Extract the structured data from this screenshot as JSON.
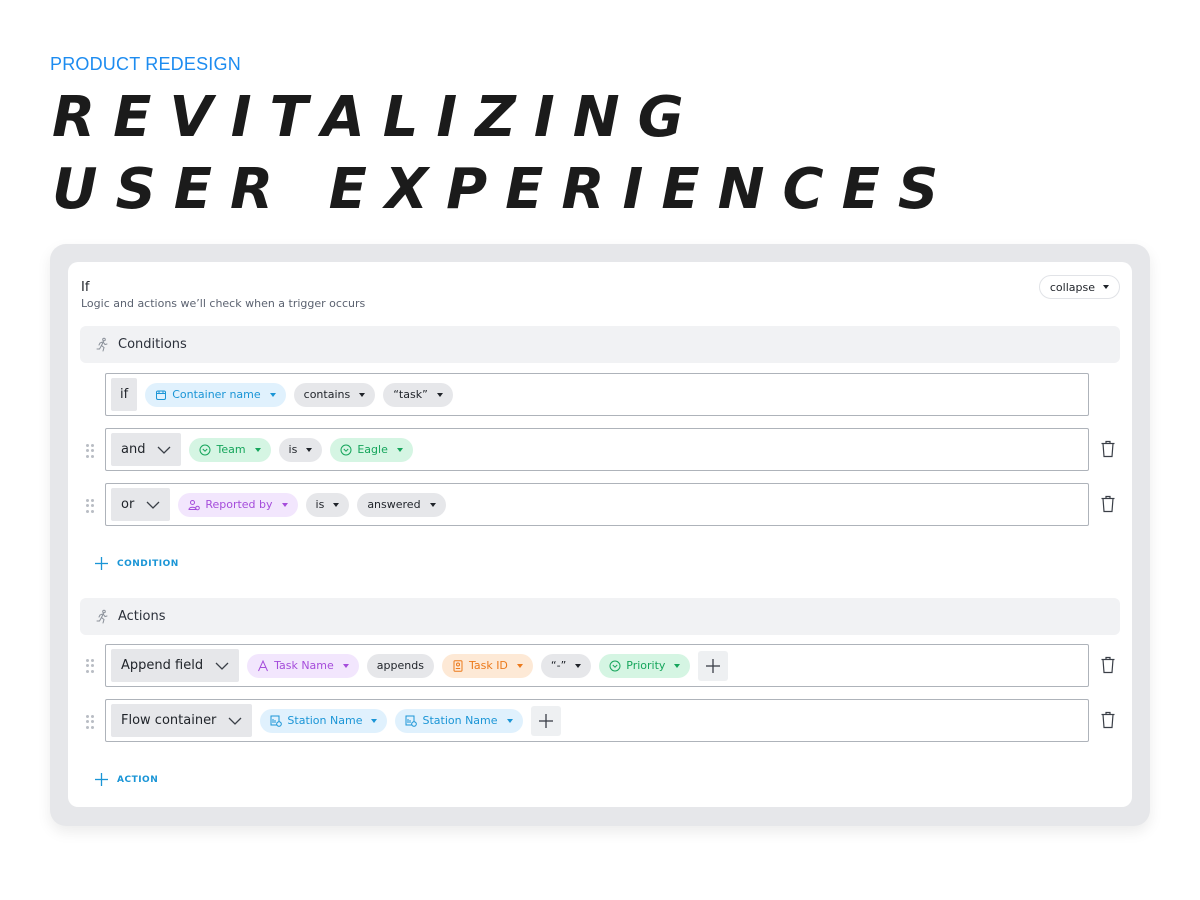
{
  "header": {
    "eyebrow": "PRODUCT REDESIGN",
    "title_line1": "REVITALIZING",
    "title_line2": "USER EXPERIENCES"
  },
  "card": {
    "title": "If",
    "subtitle": "Logic and actions we’ll check when a trigger occurs",
    "collapse_label": "collapse"
  },
  "conditions": {
    "section_label": "Conditions",
    "section_icon": "running-person-icon",
    "rows": [
      {
        "operator": "if",
        "chips": [
          {
            "label": "Container name",
            "icon": "container-icon",
            "color": "blue"
          },
          {
            "label": "contains",
            "color": "gray"
          },
          {
            "label": "“task”",
            "color": "gray"
          }
        ]
      },
      {
        "operator": "and",
        "chips": [
          {
            "label": "Team",
            "icon": "circle-chevron-icon",
            "color": "green"
          },
          {
            "label": "is",
            "color": "gray"
          },
          {
            "label": "Eagle",
            "icon": "circle-chevron-icon",
            "color": "green"
          }
        ]
      },
      {
        "operator": "or",
        "chips": [
          {
            "label": "Reported by",
            "icon": "user-icon",
            "color": "purple"
          },
          {
            "label": "is",
            "color": "gray"
          },
          {
            "label": "answered",
            "color": "gray"
          }
        ]
      }
    ],
    "add_label": "CONDITION"
  },
  "actions": {
    "section_label": "Actions",
    "section_icon": "running-person-icon",
    "rows": [
      {
        "operator": "Append field",
        "chips": [
          {
            "label": "Task Name",
            "icon": "text-icon",
            "color": "purple"
          },
          {
            "label": "appends",
            "color": "gray"
          },
          {
            "label": "Task ID",
            "icon": "id-badge-icon",
            "color": "orange"
          },
          {
            "label": "“-”",
            "color": "gray"
          },
          {
            "label": "Priority",
            "icon": "circle-chevron-icon",
            "color": "green"
          }
        ]
      },
      {
        "operator": "Flow container",
        "chips": [
          {
            "label": "Station Name",
            "icon": "station-icon",
            "color": "blue"
          },
          {
            "label": "Station Name",
            "icon": "station-icon",
            "color": "blue"
          }
        ]
      }
    ],
    "add_label": "ACTION"
  },
  "colors": {
    "accent": "#1d8cf0",
    "blue_chip": "#1a95d6",
    "green_chip": "#15a55b",
    "purple_chip": "#a54cdb",
    "orange_chip": "#ec7a1c"
  }
}
